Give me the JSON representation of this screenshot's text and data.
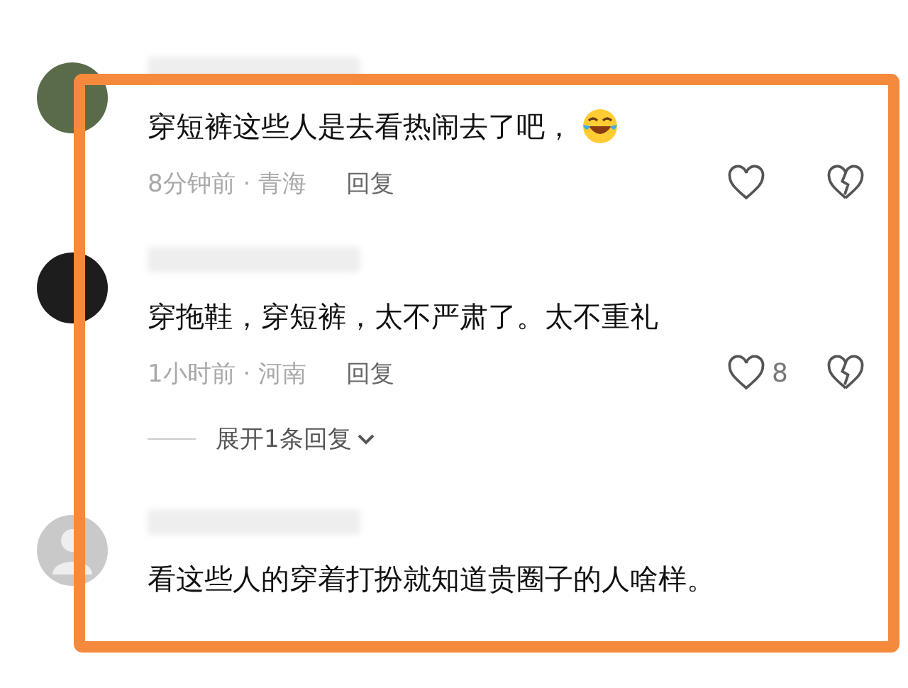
{
  "comments": [
    {
      "kind": "photo",
      "text": "穿短裤这些人是去看热闹去了吧，",
      "emoji": true,
      "time": "8分钟前",
      "separator": "·",
      "location": "青海",
      "reply": "回复"
    },
    {
      "kind": "photo",
      "text": "穿拖鞋，穿短裤，太不严肃了。太不重礼",
      "time": "1小时前",
      "separator": "·",
      "location": "河南",
      "reply": "回复",
      "likes": "8",
      "replies_toggle": "展开1条回复"
    },
    {
      "kind": "default",
      "text": "看这些人的穿着打扮就知道贵圈子的人啥样。"
    }
  ]
}
